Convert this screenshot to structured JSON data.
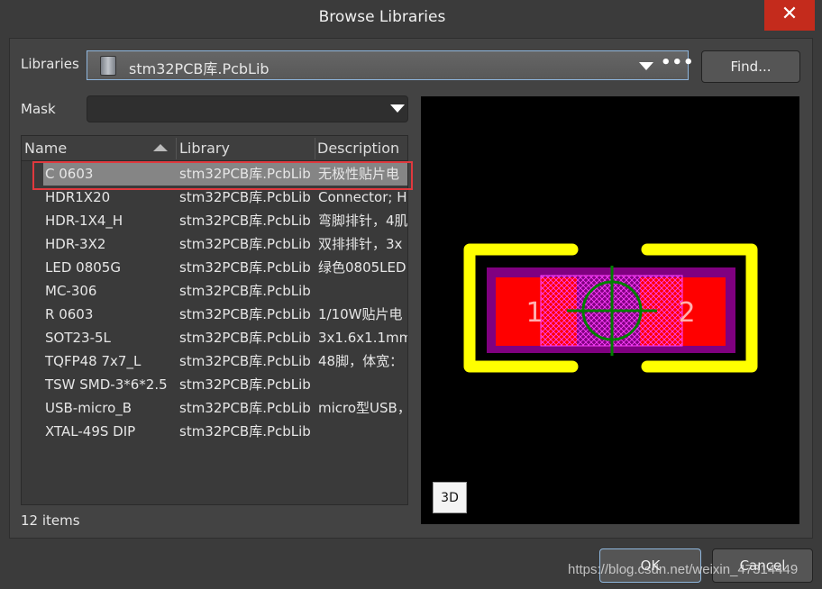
{
  "window": {
    "title": "Browse Libraries",
    "close_icon": "close-icon"
  },
  "libraries": {
    "label": "Libraries",
    "value": "stm32PCB库.PcbLib",
    "more": "•••",
    "find_label": "Find..."
  },
  "mask": {
    "label": "Mask",
    "value": ""
  },
  "list": {
    "columns": [
      "Name",
      "Library",
      "Description"
    ],
    "sort_column": "Name",
    "sort_direction": "ascending",
    "rows": [
      {
        "name": "C 0603",
        "library": "stm32PCB库.PcbLib",
        "description": "无极性贴片电"
      },
      {
        "name": "HDR1X20",
        "library": "stm32PCB库.PcbLib",
        "description": "Connector; H"
      },
      {
        "name": "HDR-1X4_H",
        "library": "stm32PCB库.PcbLib",
        "description": "弯脚排针，4肌"
      },
      {
        "name": "HDR-3X2",
        "library": "stm32PCB库.PcbLib",
        "description": "双排排针，3x"
      },
      {
        "name": "LED 0805G",
        "library": "stm32PCB库.PcbLib",
        "description": "绿色0805LED"
      },
      {
        "name": "MC-306",
        "library": "stm32PCB库.PcbLib",
        "description": ""
      },
      {
        "name": "R 0603",
        "library": "stm32PCB库.PcbLib",
        "description": "1/10W贴片电"
      },
      {
        "name": "SOT23-5L",
        "library": "stm32PCB库.PcbLib",
        "description": "3x1.6x1.1mm"
      },
      {
        "name": "TQFP48 7x7_L",
        "library": "stm32PCB库.PcbLib",
        "description": "48脚，体宽："
      },
      {
        "name": "TSW SMD-3*6*2.5",
        "library": "stm32PCB库.PcbLib",
        "description": ""
      },
      {
        "name": "USB-micro_B",
        "library": "stm32PCB库.PcbLib",
        "description": "micro型USB，"
      },
      {
        "name": "XTAL-49S DIP",
        "library": "stm32PCB库.PcbLib",
        "description": ""
      }
    ],
    "selected_index": 0,
    "count_label": "12 items"
  },
  "preview": {
    "pad1": "1",
    "pad2": "2",
    "btn_3d": "3D",
    "colors": {
      "overlay": "#ffff00",
      "pad": "#ff0000",
      "body": "#800080",
      "courtyard": "#ff00ff",
      "center": "#008000"
    }
  },
  "buttons": {
    "ok": "OK",
    "cancel": "Cancel"
  },
  "watermark": "https://blog.csdn.net/weixin_47314449"
}
